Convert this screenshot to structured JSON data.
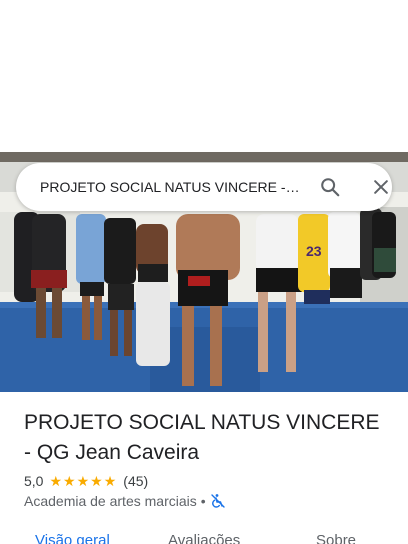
{
  "search": {
    "query": "PROJETO SOCIAL NATUS VINCERE - QG Jean Caveira"
  },
  "place": {
    "title": "PROJETO SOCIAL NATUS VINCERE - QG Jean Caveira",
    "rating": "5,0",
    "stars": 5,
    "review_count": "(45)",
    "category": "Academia de artes marciais",
    "separator": "•",
    "accessibility_icon": "no-wheelchair-access-icon"
  },
  "tabs": [
    {
      "label": "Visão geral",
      "active": true
    },
    {
      "label": "Avaliações",
      "active": false
    },
    {
      "label": "Sobre",
      "active": false
    }
  ],
  "colors": {
    "accent": "#1a73e8",
    "star": "#f9ab00",
    "text": "#202124",
    "secondary": "#5f6368"
  }
}
